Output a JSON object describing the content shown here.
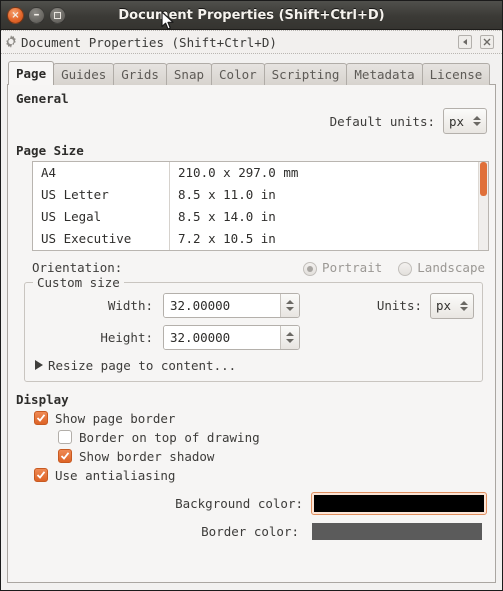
{
  "window": {
    "title": "Document Properties (Shift+Ctrl+D)",
    "controls": {
      "close": "×",
      "minimize": "–",
      "maximize": "□"
    }
  },
  "dialog_header": {
    "icon": "gear-icon",
    "title": "Document Properties (Shift+Ctrl+D)",
    "dock_button": "dock-left",
    "close_button": "close"
  },
  "tabs": [
    {
      "label": "Page",
      "active": true
    },
    {
      "label": "Guides",
      "active": false
    },
    {
      "label": "Grids",
      "active": false
    },
    {
      "label": "Snap",
      "active": false
    },
    {
      "label": "Color",
      "active": false
    },
    {
      "label": "Scripting",
      "active": false
    },
    {
      "label": "Metadata",
      "active": false
    },
    {
      "label": "License",
      "active": false
    }
  ],
  "general": {
    "heading": "General",
    "default_units_label": "Default units:",
    "default_units_value": "px"
  },
  "page_size": {
    "heading": "Page Size",
    "rows": [
      {
        "name": "A4",
        "dimensions": "210.0 x 297.0 mm"
      },
      {
        "name": "US Letter",
        "dimensions": "8.5 x 11.0 in"
      },
      {
        "name": "US Legal",
        "dimensions": "8.5 x 14.0 in"
      },
      {
        "name": "US Executive",
        "dimensions": "7.2 x 10.5 in"
      }
    ]
  },
  "orientation": {
    "label": "Orientation:",
    "portrait_label": "Portrait",
    "landscape_label": "Landscape",
    "selected": "Portrait",
    "enabled": false
  },
  "custom_size": {
    "legend": "Custom size",
    "width_label": "Width:",
    "width_value": "32.00000",
    "height_label": "Height:",
    "height_value": "32.00000",
    "units_label": "Units:",
    "units_value": "px",
    "resize_expander_label": "Resize page to content..."
  },
  "display": {
    "heading": "Display",
    "checkboxes": [
      {
        "label": "Show page border",
        "checked": true,
        "indent": 0
      },
      {
        "label": "Border on top of drawing",
        "checked": false,
        "indent": 1
      },
      {
        "label": "Show border shadow",
        "checked": true,
        "indent": 1
      },
      {
        "label": "Use antialiasing",
        "checked": true,
        "indent": 0
      }
    ],
    "background_color_label": "Background color:",
    "background_color_value": "#000000",
    "border_color_label": "Border color:",
    "border_color_value": "#5b5b5b"
  },
  "theme": {
    "accent": "#e0703a",
    "titlebar": "#3b3a36",
    "panel_bg": "#f6f5f4"
  }
}
